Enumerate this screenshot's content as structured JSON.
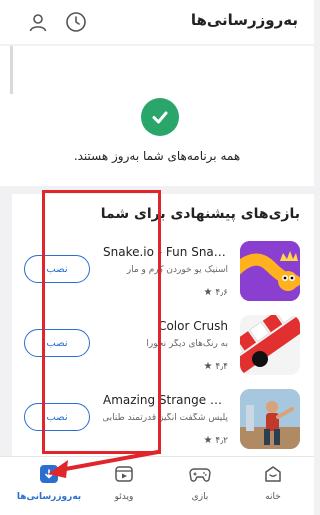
{
  "header": {
    "title": "به‌روزرسانی‌ها"
  },
  "status": {
    "message": "همه برنامه‌های شما به‌روز هستند."
  },
  "suggestions": {
    "title": "بازی‌های پیشنهادی برای شما",
    "games": [
      {
        "name": "Snake.io - Fun Snake .io Games",
        "desc": "اسنیک یو خوردن کِرم و مار",
        "rating": "۴٫۶",
        "install": "نصب"
      },
      {
        "name": "Color Crush",
        "desc": "به رنگ‌های دیگر نخورا",
        "rating": "۴٫۴",
        "install": "نصب"
      },
      {
        "name": "Amazing Strange Rope Police",
        "desc": "پلیس شگفت انگیز قدرتمند طنابی",
        "rating": "۴٫۲",
        "install": "نصب"
      }
    ]
  },
  "nav": {
    "home": "خانه",
    "games": "بازی",
    "video": "ویدئو",
    "updates": "به‌روزرسانی‌ها"
  },
  "colors": {
    "accent": "#2a6fcf",
    "success": "#2aa66a",
    "annotation": "#e0262a"
  }
}
